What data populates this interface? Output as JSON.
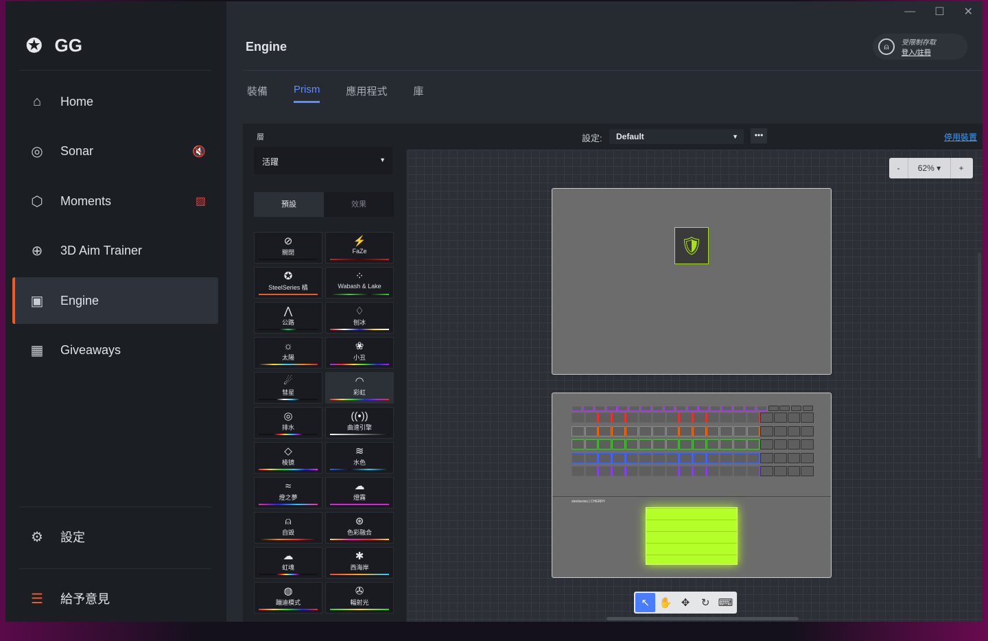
{
  "app": {
    "logo": "GG",
    "window_controls": [
      "—",
      "☐",
      "✕"
    ]
  },
  "sidebar": {
    "items": [
      {
        "label": "Home",
        "icon": "home-icon",
        "glyph": "⌂"
      },
      {
        "label": "Sonar",
        "icon": "sonar-icon",
        "glyph": "◎",
        "warn": "🔇"
      },
      {
        "label": "Moments",
        "icon": "moments-icon",
        "glyph": "⬡",
        "warn": "▨"
      },
      {
        "label": "3D Aim Trainer",
        "icon": "aim-icon",
        "glyph": "⊕"
      },
      {
        "label": "Engine",
        "icon": "engine-icon",
        "glyph": "▣",
        "active": true
      },
      {
        "label": "Giveaways",
        "icon": "gift-icon",
        "glyph": "▦"
      }
    ],
    "settings": "設定",
    "feedback": "給予意見"
  },
  "header": {
    "title": "Engine",
    "account": {
      "status": "受限制存取",
      "link": "登入/註冊"
    }
  },
  "tabs": [
    "裝備",
    "Prism",
    "應用程式",
    "庫"
  ],
  "toolbar": {
    "config_label": "設定:",
    "config_value": "Default",
    "more": "•••",
    "disable": "停用裝置"
  },
  "left_panel": {
    "layer_label": "層",
    "layer_value": "活躍",
    "segments": [
      "預設",
      "效果"
    ],
    "effects": [
      {
        "name": "關閉",
        "glyph": "⊘",
        "line": "#111"
      },
      {
        "name": "FaZe",
        "glyph": "⚡",
        "line": "linear-gradient(90deg,#d02020,#500,#d02020)"
      },
      {
        "name": "SteelSeries 橘",
        "glyph": "✪",
        "line": "#f05a28"
      },
      {
        "name": "Wabash & Lake",
        "glyph": "⁘",
        "line": "linear-gradient(90deg,#111,#4c4,#111,#4c4)"
      },
      {
        "name": "公路",
        "glyph": "⋀",
        "line": "linear-gradient(90deg,#111 35%,#2c6 50%,#111 65%)"
      },
      {
        "name": "刨冰",
        "glyph": "♢",
        "line": "linear-gradient(90deg,#d22,#fff,#22d,#fd2,#fff)"
      },
      {
        "name": "太陽",
        "glyph": "☼",
        "line": "linear-gradient(90deg,#113,#fd2,#2cf,#f80,#d22)"
      },
      {
        "name": "小丑",
        "glyph": "❀",
        "line": "linear-gradient(90deg,#a2f,#f22,#fd2,#2d2,#22f,#a2f)"
      },
      {
        "name": "彗星",
        "glyph": "☄",
        "line": "linear-gradient(90deg,#111 30%,#fff,#2cf,#111 70%)"
      },
      {
        "name": "彩虹",
        "glyph": "◠",
        "line": "linear-gradient(90deg,#f22,#fd2,#2d2,#22f,#a2f,#f22)",
        "on": true
      },
      {
        "name": "排水",
        "glyph": "◎",
        "line": "linear-gradient(90deg,#111 25%,#f22,#fd2,#2cf,#a2f,#111 75%)"
      },
      {
        "name": "曲速引擎",
        "glyph": "((•))",
        "line": "linear-gradient(90deg,#fff,#888,#111)"
      },
      {
        "name": "棱镜",
        "glyph": "◇",
        "line": "linear-gradient(90deg,#f22,#fd2,#2d2,#2cf,#22f,#f2f)"
      },
      {
        "name": "水色",
        "glyph": "≋",
        "line": "linear-gradient(90deg,#26f,#111,#2cf,#111)"
      },
      {
        "name": "燈之夢",
        "glyph": "≈",
        "line": "linear-gradient(90deg,#f2a,#22f,#2cf,#f2a)"
      },
      {
        "name": "燈霧",
        "glyph": "☁",
        "line": "#d2d"
      },
      {
        "name": "自毀",
        "glyph": "⍝",
        "line": "linear-gradient(90deg,#111,#f80,#f22,#111)"
      },
      {
        "name": "色彩融合",
        "glyph": "⊛",
        "line": "linear-gradient(90deg,#fd2,#f2a,#f22,#fd2)"
      },
      {
        "name": "虹魂",
        "glyph": "☁",
        "line": "linear-gradient(90deg,#111 30%,#f22,#fd2,#2cf,#a2f,#111 70%)"
      },
      {
        "name": "西海岸",
        "glyph": "✱",
        "line": "linear-gradient(90deg,#f42,#fa2,#2cf)"
      },
      {
        "name": "蹦迪模式",
        "glyph": "◍",
        "line": "linear-gradient(90deg,#f22,#fd2,#2d2,#22f,#f22)"
      },
      {
        "name": "輻射光",
        "glyph": "✇",
        "line": "linear-gradient(90deg,#2d2,#fd2,#2d2)"
      }
    ]
  },
  "canvas": {
    "zoom": "62%",
    "zoom_minus": "-",
    "zoom_plus": "+",
    "brand": "steelseries | CHERRY",
    "tools": [
      "↖",
      "✋",
      "✥",
      "↻",
      "⌨"
    ]
  },
  "colors": {
    "accent": "#5f8cff",
    "orange": "#f05a28",
    "pad": "#b4ff2a"
  }
}
